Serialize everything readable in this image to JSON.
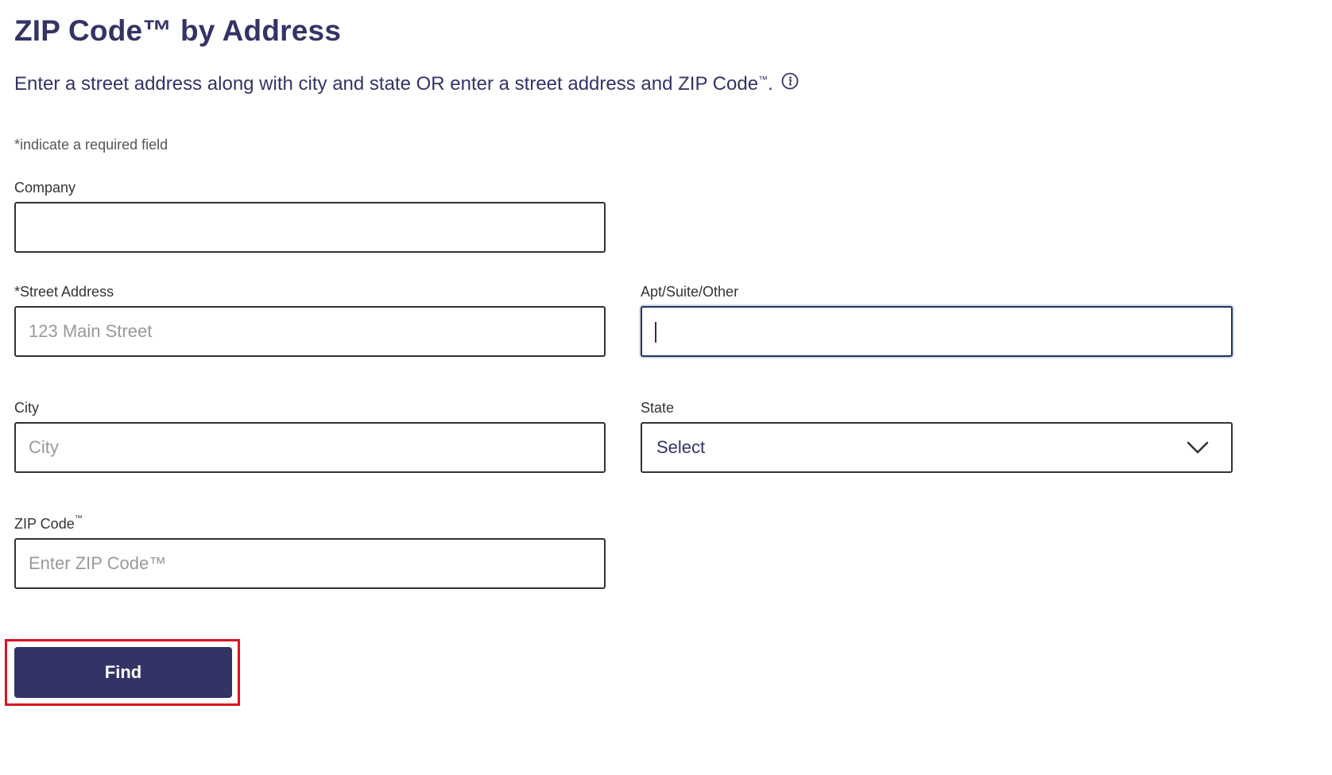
{
  "title": "ZIP Code™ by Address",
  "intro": {
    "text": "Enter a street address along with city and state OR enter a street address and ZIP Code",
    "tm": "™",
    "period": "."
  },
  "required_note": "*indicate a required field",
  "fields": {
    "company": {
      "label": "Company",
      "value": "",
      "placeholder": ""
    },
    "street": {
      "label": "*Street Address",
      "value": "",
      "placeholder": "123 Main Street"
    },
    "apt": {
      "label": "Apt/Suite/Other",
      "value": "",
      "placeholder": ""
    },
    "city": {
      "label": "City",
      "value": "",
      "placeholder": "City"
    },
    "state": {
      "label": "State",
      "selected": "Select"
    },
    "zip": {
      "label": "ZIP Code",
      "label_tm": "™",
      "value": "",
      "placeholder": "Enter ZIP Code™"
    }
  },
  "find_button": {
    "label": "Find"
  },
  "colors": {
    "brand_navy": "#333366",
    "highlight_red": "#dd1122",
    "border": "#333333",
    "placeholder": "#999999"
  },
  "icons": {
    "info": "info-icon",
    "chevron": "chevron-down-icon"
  }
}
